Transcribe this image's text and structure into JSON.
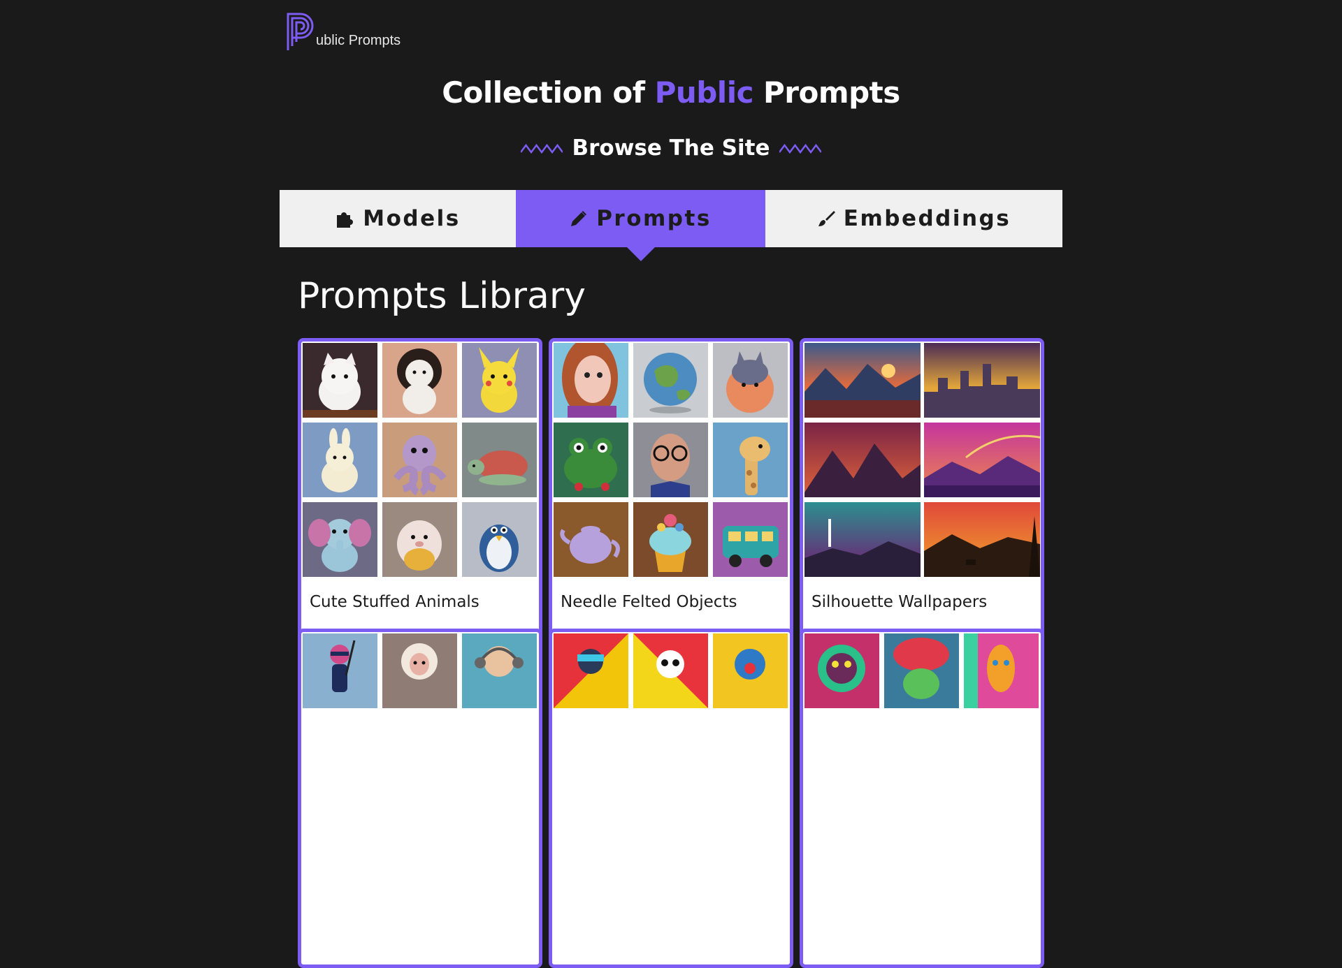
{
  "logo": {
    "letter_icon": "p-logo-icon",
    "text": "ublic Prompts"
  },
  "hero": {
    "prefix": "Collection of",
    "accent": "Public",
    "suffix": "Prompts",
    "accent_color": "#7c5cf2"
  },
  "browse": {
    "label": "Browse The Site",
    "decor_icon": "wave-icon"
  },
  "tabs": [
    {
      "label": "Models",
      "icon": "puzzle-icon",
      "active": false
    },
    {
      "label": "Prompts",
      "icon": "pencil-icon",
      "active": true
    },
    {
      "label": "Embeddings",
      "icon": "brush-icon",
      "active": false
    }
  ],
  "section": {
    "title": "Prompts Library"
  },
  "cards": [
    {
      "label": "Cute Stuffed Animals"
    },
    {
      "label": "Needle Felted Objects"
    },
    {
      "label": "Silhouette Wallpapers"
    },
    {
      "label": ""
    },
    {
      "label": ""
    },
    {
      "label": ""
    }
  ],
  "colors": {
    "background": "#1a1a1b",
    "accent": "#7c5cf2",
    "tab_bg": "#f0f0f0"
  }
}
